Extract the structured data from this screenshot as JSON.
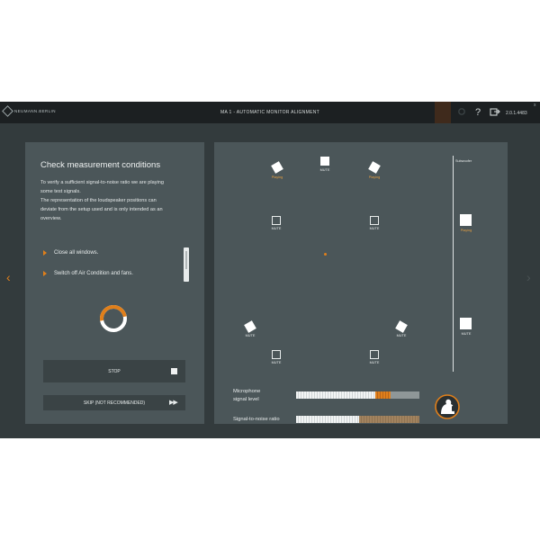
{
  "topbar": {
    "logo_text": "NEUMANN.BERLIN",
    "title": "MA 1 - AUTOMATIC MONITOR ALIGNMENT",
    "icons": [
      "gear-icon",
      "help-icon",
      "export-icon"
    ],
    "help_glyph": "?",
    "version": "2.0.1.4483",
    "close_glyph": "x"
  },
  "nav": {
    "back_glyph": "‹",
    "forward_glyph": "›"
  },
  "left_panel": {
    "title": "Check measurement conditions",
    "description_lines": [
      "To verify a sufficient signal-to-noise ratio we are playing",
      "some test signals.",
      "The representation of the loudspeaker positions can",
      "deviate from the setup used and is only intended as an",
      "overview."
    ],
    "conditions": [
      "Close all windows.",
      "Switch off Air Condition and fans."
    ],
    "stop_label": "STOP",
    "skip_label": "SKIP (NOT RECOMMENDED)",
    "skip_glyph": "▶▶"
  },
  "speakers": {
    "playing_label": "Playing",
    "mute_label": "MUTE",
    "subwoofer_title": "Subwoofer",
    "items": [
      {
        "id": "front-left",
        "state": "Playing"
      },
      {
        "id": "center",
        "state": "MUTE"
      },
      {
        "id": "front-right",
        "state": "Playing"
      },
      {
        "id": "mid-left",
        "state": "MUTE"
      },
      {
        "id": "mid-right",
        "state": "MUTE"
      },
      {
        "id": "sub-1",
        "state": "Playing"
      },
      {
        "id": "rear-left",
        "state": "MUTE"
      },
      {
        "id": "rear-right",
        "state": "MUTE"
      },
      {
        "id": "sub-2",
        "state": "MUTE"
      },
      {
        "id": "back-left",
        "state": "MUTE"
      },
      {
        "id": "back-right",
        "state": "MUTE"
      }
    ]
  },
  "meters": {
    "mic_label_line1": "Microphone",
    "mic_label_line2": "signal level",
    "snr_label": "Signal-to-noise ratio",
    "mic_level": 0.64,
    "mic_peak": 0.77,
    "snr_level": 0.51
  },
  "colors": {
    "accent": "#e07f1a",
    "background": "#333b3d",
    "panel": "#4b5659",
    "topbar": "#1c2022"
  }
}
